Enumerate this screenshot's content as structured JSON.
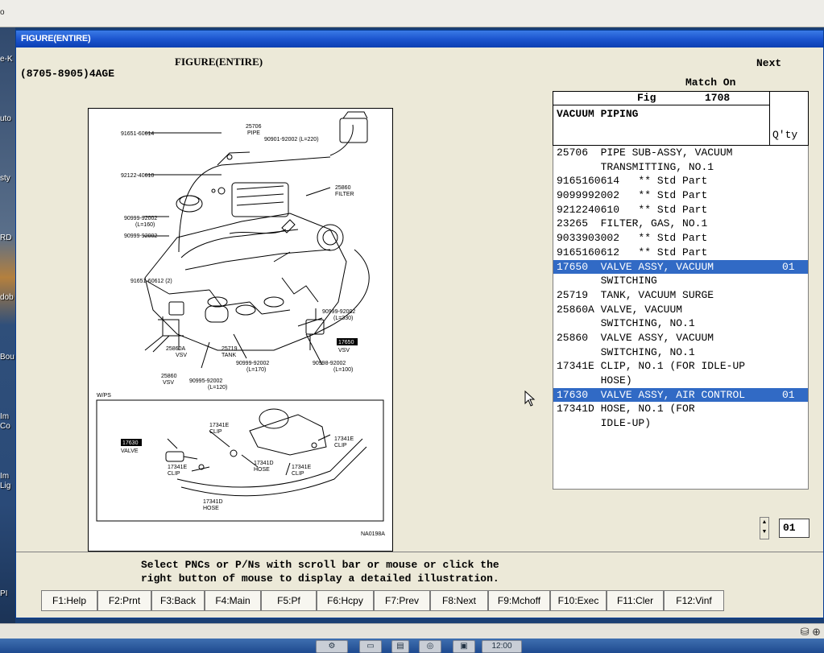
{
  "host": {
    "top_glyph": "o"
  },
  "desktop": {
    "labels": [
      "e-K",
      "uto",
      "sty",
      "RD",
      "dob",
      "Bou",
      "Im",
      "Co",
      "Im",
      "Lig",
      "PI"
    ]
  },
  "window": {
    "title": "FIGURE(ENTIRE)"
  },
  "screen": {
    "model_code": "(8705-8905)4AGE",
    "figure_header": "FIGURE(ENTIRE)",
    "next_label": "Next",
    "match_on_label": "Match On"
  },
  "figure": {
    "fig_label": "Fig",
    "fig_number": "1708",
    "group_name": "VACUUM PIPING",
    "qty_label": "Q'ty"
  },
  "illustration": {
    "image_code": "NA0198A",
    "inset_label": "W/PS",
    "callouts": {
      "c_25706": "25706",
      "c_pipe": "PIPE",
      "c_90901": "90901-92002 (L=220)",
      "c_91651": "91651-60614",
      "c_92122": "92122-40610",
      "c_25860_filter": "25860",
      "c_filter": "FILTER",
      "c_90999a": "90999-92002",
      "c_l160": "(L=160)",
      "c_90999b": "90999-92002",
      "c_91651b": "91651-60612 (2)",
      "c_25860a": "25860A",
      "c_vsv1": "VSV",
      "c_25860": "25860",
      "c_vsv2": "VSV",
      "c_25719": "25719",
      "c_tank": "TANK",
      "c_90999c": "90999-92002",
      "c_l170": "(L=170)",
      "c_90995": "90995-92002",
      "c_l120": "(L=120)",
      "c_90999d": "90999-92002",
      "c_l330": "(L=330)",
      "c_17650": "17650",
      "c_vsv3": "VSV",
      "c_90998": "90998-92002",
      "c_l100": "(L=100)",
      "c_17630": "17630",
      "c_valve": "VALVE",
      "c_17341e_a": "17341E",
      "c_clip_a": "CLIP",
      "c_17341e_b": "17341E",
      "c_clip_b": "CLIP",
      "c_17341d_a": "17341D",
      "c_hose_a": "HOSE",
      "c_17341e_c": "17341E",
      "c_clip_c": "CLIP",
      "c_17341e_d": "17341E",
      "c_clip_d": "CLIP",
      "c_17341d_b": "17341D",
      "c_hose_b": "HOSE"
    }
  },
  "parts": [
    {
      "pnc": "25706 ",
      "desc": "PIPE SUB-ASSY, VACUUM",
      "qty": "",
      "selected": false
    },
    {
      "pnc": "      ",
      "desc": "TRANSMITTING, NO.1",
      "qty": "",
      "selected": false
    },
    {
      "pnc": "9165160614",
      "desc": "  ** Std Part",
      "qty": "",
      "selected": false
    },
    {
      "pnc": "9099992002",
      "desc": "  ** Std Part",
      "qty": "",
      "selected": false
    },
    {
      "pnc": "9212240610",
      "desc": "  ** Std Part",
      "qty": "",
      "selected": false
    },
    {
      "pnc": "23265 ",
      "desc": "FILTER, GAS, NO.1",
      "qty": "",
      "selected": false
    },
    {
      "pnc": "9033903002",
      "desc": "  ** Std Part",
      "qty": "",
      "selected": false
    },
    {
      "pnc": "9165160612",
      "desc": "  ** Std Part",
      "qty": "",
      "selected": false
    },
    {
      "pnc": "17650 ",
      "desc": "VALVE ASSY, VACUUM",
      "qty": "01",
      "selected": true
    },
    {
      "pnc": "      ",
      "desc": "SWITCHING",
      "qty": "",
      "selected": false
    },
    {
      "pnc": "25719 ",
      "desc": "TANK, VACUUM SURGE",
      "qty": "",
      "selected": false
    },
    {
      "pnc": "25860A",
      "desc": "VALVE, VACUUM",
      "qty": "",
      "selected": false
    },
    {
      "pnc": "      ",
      "desc": "SWITCHING, NO.1",
      "qty": "",
      "selected": false
    },
    {
      "pnc": "25860 ",
      "desc": "VALVE ASSY, VACUUM",
      "qty": "",
      "selected": false
    },
    {
      "pnc": "      ",
      "desc": "SWITCHING, NO.1",
      "qty": "",
      "selected": false
    },
    {
      "pnc": "17341E",
      "desc": "CLIP, NO.1 (FOR IDLE-UP",
      "qty": "",
      "selected": false
    },
    {
      "pnc": "      ",
      "desc": "HOSE)",
      "qty": "",
      "selected": false
    },
    {
      "pnc": "17630 ",
      "desc": "VALVE ASSY, AIR CONTROL",
      "qty": "01",
      "selected": true
    },
    {
      "pnc": "17341D",
      "desc": "HOSE, NO.1 (FOR",
      "qty": "",
      "selected": false
    },
    {
      "pnc": "      ",
      "desc": "IDLE-UP)",
      "qty": "",
      "selected": false
    }
  ],
  "qty_input": {
    "value": "01",
    "spinner_up": "▲",
    "spinner_down": "▼"
  },
  "instructions": {
    "line1": "Select PNCs or P/Ns with scroll bar or mouse or click the",
    "line2": "right button of mouse to display a detailed illustration."
  },
  "function_keys": [
    {
      "label": "F1:Help"
    },
    {
      "label": "F2:Prnt"
    },
    {
      "label": "F3:Back"
    },
    {
      "label": "F4:Main"
    },
    {
      "label": "F5:Pf"
    },
    {
      "label": "F6:Hcpy"
    },
    {
      "label": "F7:Prev"
    },
    {
      "label": "F8:Next"
    },
    {
      "label": "F9:Mchoff"
    },
    {
      "label": "F10:Exec"
    },
    {
      "label": "F11:Cler"
    },
    {
      "label": "F12:Vinf"
    }
  ],
  "status_bar": {
    "icons": "⛁ ⊕"
  },
  "taskbar": {
    "clock": "12:00"
  }
}
